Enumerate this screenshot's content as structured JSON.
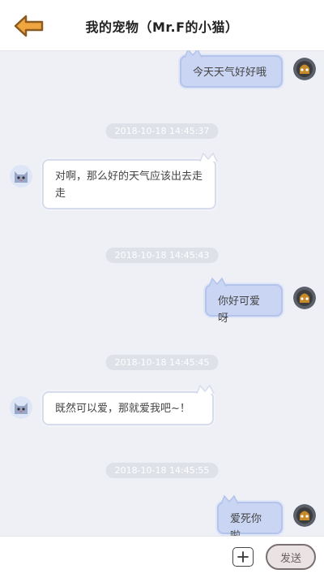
{
  "header": {
    "title": "我的宠物（Mr.F的小猫）"
  },
  "messages": [
    {
      "type": "message",
      "from": "me",
      "text": "今天天气好好哦"
    },
    {
      "type": "timestamp",
      "text": "2018-10-18 14:45:37"
    },
    {
      "type": "message",
      "from": "pet",
      "text": "对啊，那么好的天气应该出去走走"
    },
    {
      "type": "timestamp",
      "text": "2018-10-18 14:45:43"
    },
    {
      "type": "message",
      "from": "me",
      "text": "你好可爱呀"
    },
    {
      "type": "timestamp",
      "text": "2018-10-18 14:45:45"
    },
    {
      "type": "message",
      "from": "pet",
      "text": "既然可以爱，那就爱我吧~！"
    },
    {
      "type": "timestamp",
      "text": "2018-10-18 14:45:55"
    },
    {
      "type": "message",
      "from": "me",
      "text": "爱死你啦"
    }
  ],
  "footer": {
    "input_placeholder": "",
    "send_label": "发送"
  },
  "icons": {
    "back": "back-arrow-icon",
    "add": "plus-icon",
    "user_avatar": "user-avatar",
    "pet_avatar": "cat-avatar"
  },
  "colors": {
    "accent": "#e8a13a",
    "outgoing_bubble": "#c9d5f2",
    "incoming_bubble": "#ffffff",
    "timestamp_pill": "#dfe1e8",
    "background": "#eef0f6"
  }
}
